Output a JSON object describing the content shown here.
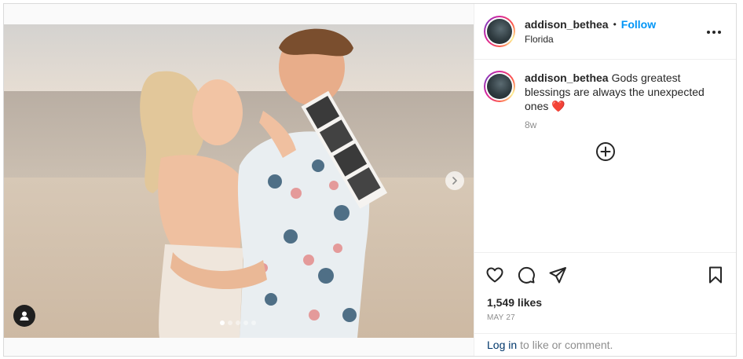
{
  "post": {
    "username": "addison_bethea",
    "follow_label": "Follow",
    "separator": "•",
    "location": "Florida",
    "caption_text": "Gods greatest blessings are always the unexpected ones",
    "caption_emoji": "❤️",
    "time_ago": "8w",
    "likes": "1,549 likes",
    "date": "MAY 27",
    "login_link": "Log in",
    "login_suffix": "to like or comment."
  },
  "carousel": {
    "slide_count": 5,
    "active_slide": 1
  },
  "icons": {
    "more": "more-options-icon",
    "next": "chevron-right-icon",
    "user_tag": "user-tag-icon",
    "load_more": "plus-circle-icon",
    "like": "heart-outline-icon",
    "comment": "comment-bubble-icon",
    "share": "paper-plane-icon",
    "save": "bookmark-icon"
  },
  "colors": {
    "accent_link": "#0095f6",
    "login_link": "#00376b",
    "muted_text": "#8e8e8e",
    "text": "#262626"
  }
}
